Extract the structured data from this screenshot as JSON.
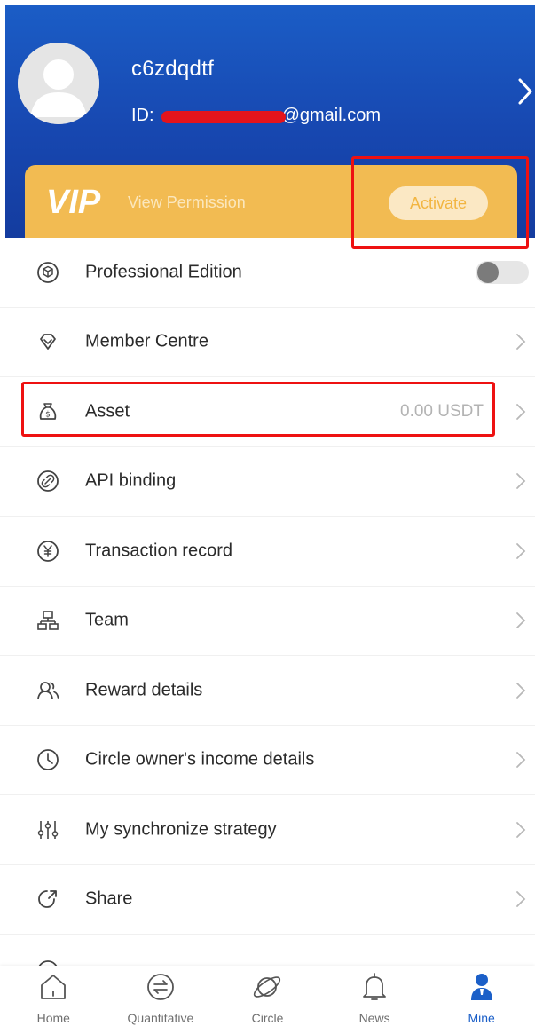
{
  "profile": {
    "username": "c6zdqdtf",
    "id_prefix": "ID:",
    "id_email_suffix": "@gmail.com",
    "avatar_icon": "user-avatar-icon",
    "arrow_icon": "chevron-right-icon"
  },
  "vip": {
    "logo": "VIP",
    "permission_label": "View Permission",
    "activate_label": "Activate"
  },
  "menu": {
    "items": [
      {
        "label": "Professional Edition",
        "icon": "cube-icon",
        "toggle": true,
        "toggle_on": false
      },
      {
        "label": "Member Centre",
        "icon": "diamond-icon"
      },
      {
        "label": "Asset",
        "icon": "money-bag-icon",
        "value": "0.00 USDT"
      },
      {
        "label": "API binding",
        "icon": "link-icon"
      },
      {
        "label": "Transaction record",
        "icon": "yen-coin-icon"
      },
      {
        "label": "Team",
        "icon": "org-chart-icon"
      },
      {
        "label": "Reward details",
        "icon": "users-icon"
      },
      {
        "label": "Circle owner's income details",
        "icon": "clock-icon"
      },
      {
        "label": "My synchronize strategy",
        "icon": "sliders-icon"
      },
      {
        "label": "Share",
        "icon": "share-icon"
      }
    ]
  },
  "tabbar": {
    "tabs": [
      {
        "label": "Home",
        "icon": "home-icon",
        "active": false
      },
      {
        "label": "Quantitative",
        "icon": "exchange-icon",
        "active": false
      },
      {
        "label": "Circle",
        "icon": "planet-icon",
        "active": false
      },
      {
        "label": "News",
        "icon": "bell-icon",
        "active": false
      },
      {
        "label": "Mine",
        "icon": "person-icon",
        "active": true
      }
    ]
  },
  "colors": {
    "header_blue": "#1747b0",
    "vip_gold": "#f2bb52",
    "highlight_red": "#ee1111",
    "active_tab": "#1b5fc8"
  }
}
